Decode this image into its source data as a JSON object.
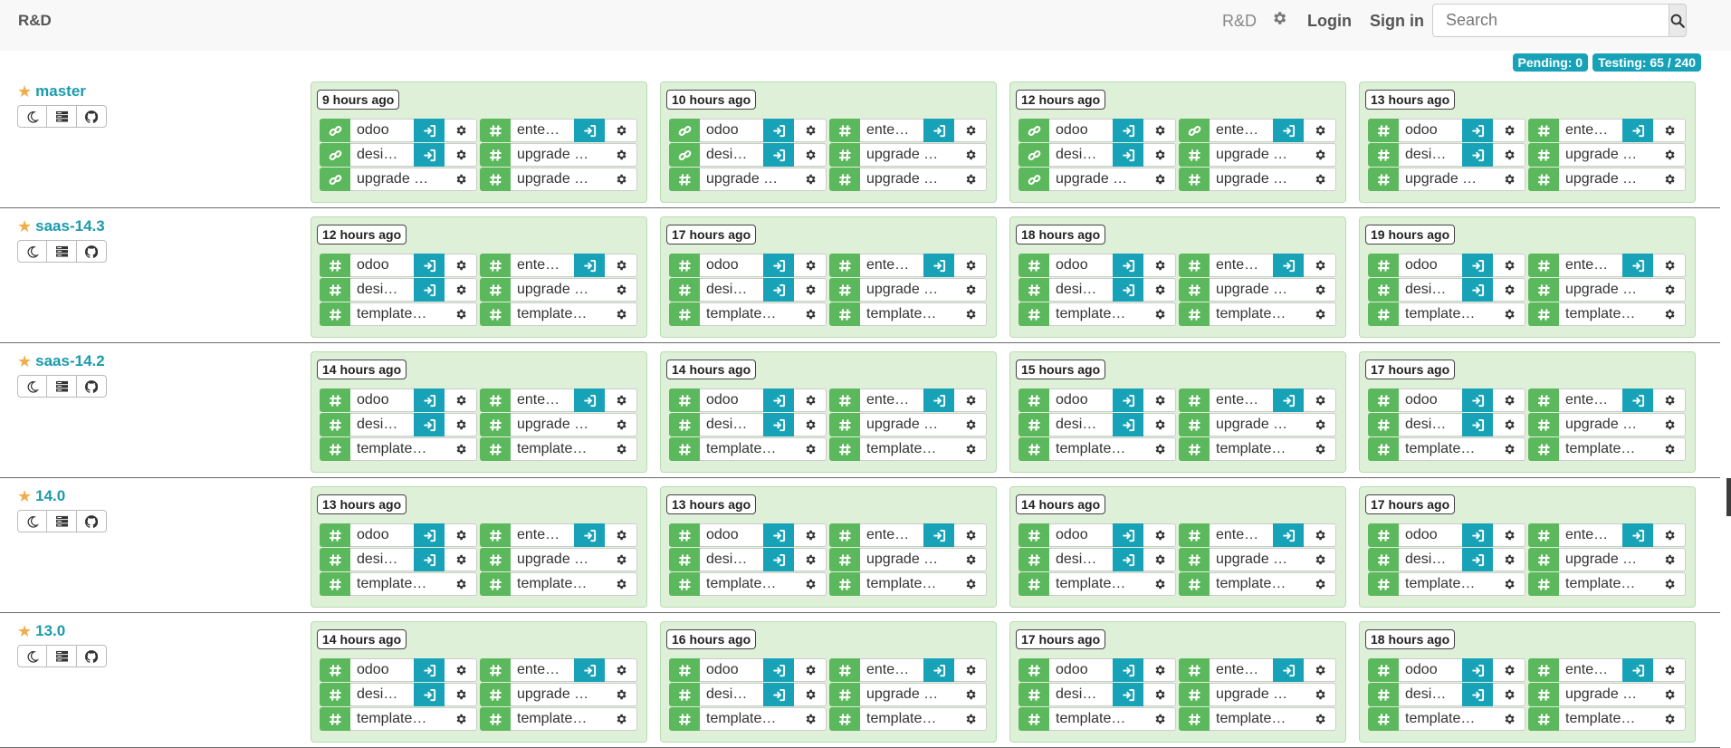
{
  "navbar": {
    "brand": "R&D",
    "project": "R&D",
    "login": "Login",
    "signin": "Sign in",
    "search_placeholder": "Search"
  },
  "status": {
    "pending": "Pending: 0",
    "testing": "Testing: 65 / 240"
  },
  "branches": [
    {
      "name": "master",
      "batches": [
        {
          "age": "9 hours ago",
          "builds": [
            {
              "name": "odoo",
              "icon": "link",
              "go": true
            },
            {
              "name": "ente…",
              "icon": "hash",
              "go": true
            },
            {
              "name": "desi…",
              "icon": "link",
              "go": true
            },
            {
              "name": "upgrade …",
              "icon": "hash",
              "go": false
            },
            {
              "name": "upgrade …",
              "icon": "link",
              "go": false
            },
            {
              "name": "upgrade …",
              "icon": "hash",
              "go": false
            }
          ]
        },
        {
          "age": "10 hours ago",
          "builds": [
            {
              "name": "odoo",
              "icon": "link",
              "go": true
            },
            {
              "name": "ente…",
              "icon": "hash",
              "go": true
            },
            {
              "name": "desi…",
              "icon": "link",
              "go": true
            },
            {
              "name": "upgrade …",
              "icon": "hash",
              "go": false
            },
            {
              "name": "upgrade …",
              "icon": "hash",
              "go": false
            },
            {
              "name": "upgrade …",
              "icon": "hash",
              "go": false
            }
          ]
        },
        {
          "age": "12 hours ago",
          "builds": [
            {
              "name": "odoo",
              "icon": "link",
              "go": true
            },
            {
              "name": "ente…",
              "icon": "link",
              "go": true
            },
            {
              "name": "desi…",
              "icon": "link",
              "go": true
            },
            {
              "name": "upgrade …",
              "icon": "hash",
              "go": false
            },
            {
              "name": "upgrade …",
              "icon": "link",
              "go": false
            },
            {
              "name": "upgrade …",
              "icon": "hash",
              "go": false
            }
          ]
        },
        {
          "age": "13 hours ago",
          "builds": [
            {
              "name": "odoo",
              "icon": "hash",
              "go": true
            },
            {
              "name": "ente…",
              "icon": "hash",
              "go": true
            },
            {
              "name": "desi…",
              "icon": "hash",
              "go": true
            },
            {
              "name": "upgrade …",
              "icon": "hash",
              "go": false
            },
            {
              "name": "upgrade …",
              "icon": "hash",
              "go": false
            },
            {
              "name": "upgrade …",
              "icon": "hash",
              "go": false
            }
          ]
        }
      ]
    },
    {
      "name": "saas-14.3",
      "batches": [
        {
          "age": "12 hours ago",
          "builds": [
            {
              "name": "odoo",
              "icon": "hash",
              "go": true
            },
            {
              "name": "ente…",
              "icon": "hash",
              "go": true
            },
            {
              "name": "desi…",
              "icon": "hash",
              "go": true
            },
            {
              "name": "upgrade …",
              "icon": "hash",
              "go": false
            },
            {
              "name": "template…",
              "icon": "hash",
              "go": false
            },
            {
              "name": "template…",
              "icon": "hash",
              "go": false
            }
          ]
        },
        {
          "age": "17 hours ago",
          "builds": [
            {
              "name": "odoo",
              "icon": "hash",
              "go": true
            },
            {
              "name": "ente…",
              "icon": "hash",
              "go": true
            },
            {
              "name": "desi…",
              "icon": "hash",
              "go": true
            },
            {
              "name": "upgrade …",
              "icon": "hash",
              "go": false
            },
            {
              "name": "template…",
              "icon": "hash",
              "go": false
            },
            {
              "name": "template…",
              "icon": "hash",
              "go": false
            }
          ]
        },
        {
          "age": "18 hours ago",
          "builds": [
            {
              "name": "odoo",
              "icon": "hash",
              "go": true
            },
            {
              "name": "ente…",
              "icon": "hash",
              "go": true
            },
            {
              "name": "desi…",
              "icon": "hash",
              "go": true
            },
            {
              "name": "upgrade …",
              "icon": "hash",
              "go": false
            },
            {
              "name": "template…",
              "icon": "hash",
              "go": false
            },
            {
              "name": "template…",
              "icon": "hash",
              "go": false
            }
          ]
        },
        {
          "age": "19 hours ago",
          "builds": [
            {
              "name": "odoo",
              "icon": "hash",
              "go": true
            },
            {
              "name": "ente…",
              "icon": "hash",
              "go": true
            },
            {
              "name": "desi…",
              "icon": "hash",
              "go": true
            },
            {
              "name": "upgrade …",
              "icon": "hash",
              "go": false
            },
            {
              "name": "template…",
              "icon": "hash",
              "go": false
            },
            {
              "name": "template…",
              "icon": "hash",
              "go": false
            }
          ]
        }
      ]
    },
    {
      "name": "saas-14.2",
      "batches": [
        {
          "age": "14 hours ago",
          "builds": [
            {
              "name": "odoo",
              "icon": "hash",
              "go": true
            },
            {
              "name": "ente…",
              "icon": "hash",
              "go": true
            },
            {
              "name": "desi…",
              "icon": "hash",
              "go": true
            },
            {
              "name": "upgrade …",
              "icon": "hash",
              "go": false
            },
            {
              "name": "template…",
              "icon": "hash",
              "go": false
            },
            {
              "name": "template…",
              "icon": "hash",
              "go": false
            }
          ]
        },
        {
          "age": "14 hours ago",
          "builds": [
            {
              "name": "odoo",
              "icon": "hash",
              "go": true
            },
            {
              "name": "ente…",
              "icon": "hash",
              "go": true
            },
            {
              "name": "desi…",
              "icon": "hash",
              "go": true
            },
            {
              "name": "upgrade …",
              "icon": "hash",
              "go": false
            },
            {
              "name": "template…",
              "icon": "hash",
              "go": false
            },
            {
              "name": "template…",
              "icon": "hash",
              "go": false
            }
          ]
        },
        {
          "age": "15 hours ago",
          "builds": [
            {
              "name": "odoo",
              "icon": "hash",
              "go": true
            },
            {
              "name": "ente…",
              "icon": "hash",
              "go": true
            },
            {
              "name": "desi…",
              "icon": "hash",
              "go": true
            },
            {
              "name": "upgrade …",
              "icon": "hash",
              "go": false
            },
            {
              "name": "template…",
              "icon": "hash",
              "go": false
            },
            {
              "name": "template…",
              "icon": "hash",
              "go": false
            }
          ]
        },
        {
          "age": "17 hours ago",
          "builds": [
            {
              "name": "odoo",
              "icon": "hash",
              "go": true
            },
            {
              "name": "ente…",
              "icon": "hash",
              "go": true
            },
            {
              "name": "desi…",
              "icon": "hash",
              "go": true
            },
            {
              "name": "upgrade …",
              "icon": "hash",
              "go": false
            },
            {
              "name": "template…",
              "icon": "hash",
              "go": false
            },
            {
              "name": "template…",
              "icon": "hash",
              "go": false
            }
          ]
        }
      ]
    },
    {
      "name": "14.0",
      "batches": [
        {
          "age": "13 hours ago",
          "builds": [
            {
              "name": "odoo",
              "icon": "hash",
              "go": true
            },
            {
              "name": "ente…",
              "icon": "hash",
              "go": true
            },
            {
              "name": "desi…",
              "icon": "hash",
              "go": true
            },
            {
              "name": "upgrade …",
              "icon": "hash",
              "go": false
            },
            {
              "name": "template…",
              "icon": "hash",
              "go": false
            },
            {
              "name": "template…",
              "icon": "hash",
              "go": false
            }
          ]
        },
        {
          "age": "13 hours ago",
          "builds": [
            {
              "name": "odoo",
              "icon": "hash",
              "go": true
            },
            {
              "name": "ente…",
              "icon": "hash",
              "go": true
            },
            {
              "name": "desi…",
              "icon": "hash",
              "go": true
            },
            {
              "name": "upgrade …",
              "icon": "hash",
              "go": false
            },
            {
              "name": "template…",
              "icon": "hash",
              "go": false
            },
            {
              "name": "template…",
              "icon": "hash",
              "go": false
            }
          ]
        },
        {
          "age": "14 hours ago",
          "builds": [
            {
              "name": "odoo",
              "icon": "hash",
              "go": true
            },
            {
              "name": "ente…",
              "icon": "hash",
              "go": true
            },
            {
              "name": "desi…",
              "icon": "hash",
              "go": true
            },
            {
              "name": "upgrade …",
              "icon": "hash",
              "go": false
            },
            {
              "name": "template…",
              "icon": "hash",
              "go": false
            },
            {
              "name": "template…",
              "icon": "hash",
              "go": false
            }
          ]
        },
        {
          "age": "17 hours ago",
          "builds": [
            {
              "name": "odoo",
              "icon": "hash",
              "go": true
            },
            {
              "name": "ente…",
              "icon": "hash",
              "go": true
            },
            {
              "name": "desi…",
              "icon": "hash",
              "go": true
            },
            {
              "name": "upgrade …",
              "icon": "hash",
              "go": false
            },
            {
              "name": "template…",
              "icon": "hash",
              "go": false
            },
            {
              "name": "template…",
              "icon": "hash",
              "go": false
            }
          ]
        }
      ]
    },
    {
      "name": "13.0",
      "batches": [
        {
          "age": "14 hours ago",
          "builds": [
            {
              "name": "odoo",
              "icon": "hash",
              "go": true
            },
            {
              "name": "ente…",
              "icon": "hash",
              "go": true
            },
            {
              "name": "desi…",
              "icon": "hash",
              "go": true
            },
            {
              "name": "upgrade …",
              "icon": "hash",
              "go": false
            },
            {
              "name": "template…",
              "icon": "hash",
              "go": false
            },
            {
              "name": "template…",
              "icon": "hash",
              "go": false
            }
          ]
        },
        {
          "age": "16 hours ago",
          "builds": [
            {
              "name": "odoo",
              "icon": "hash",
              "go": true
            },
            {
              "name": "ente…",
              "icon": "hash",
              "go": true
            },
            {
              "name": "desi…",
              "icon": "hash",
              "go": true
            },
            {
              "name": "upgrade …",
              "icon": "hash",
              "go": false
            },
            {
              "name": "template…",
              "icon": "hash",
              "go": false
            },
            {
              "name": "template…",
              "icon": "hash",
              "go": false
            }
          ]
        },
        {
          "age": "17 hours ago",
          "builds": [
            {
              "name": "odoo",
              "icon": "hash",
              "go": true
            },
            {
              "name": "ente…",
              "icon": "hash",
              "go": true
            },
            {
              "name": "desi…",
              "icon": "hash",
              "go": true
            },
            {
              "name": "upgrade …",
              "icon": "hash",
              "go": false
            },
            {
              "name": "template…",
              "icon": "hash",
              "go": false
            },
            {
              "name": "template…",
              "icon": "hash",
              "go": false
            }
          ]
        },
        {
          "age": "18 hours ago",
          "builds": [
            {
              "name": "odoo",
              "icon": "hash",
              "go": true
            },
            {
              "name": "ente…",
              "icon": "hash",
              "go": true
            },
            {
              "name": "desi…",
              "icon": "hash",
              "go": true
            },
            {
              "name": "upgrade …",
              "icon": "hash",
              "go": false
            },
            {
              "name": "template…",
              "icon": "hash",
              "go": false
            },
            {
              "name": "template…",
              "icon": "hash",
              "go": false
            }
          ]
        }
      ]
    }
  ],
  "colors": {
    "status_ok": "#5cb85c",
    "go_button": "#17a2b8",
    "card_bg": "#dff0d8",
    "branch_link": "#1b9bac",
    "star": "#f0ad4e"
  }
}
